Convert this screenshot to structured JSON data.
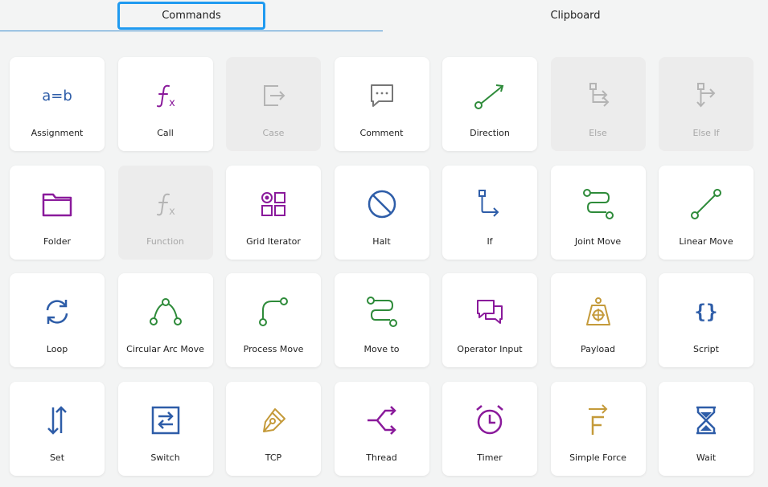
{
  "tabs": {
    "commands": "Commands",
    "clipboard": "Clipboard"
  },
  "colors": {
    "blue": "#2e5da8",
    "purple": "#8a1a9b",
    "green": "#2e8b3a",
    "gray": "#777777",
    "disabled": "#b4b4b4",
    "gold": "#c49a3a",
    "focus": "#1f9af0"
  },
  "commands": [
    {
      "label": "Assignment",
      "icon": "assignment-icon",
      "disabled": false
    },
    {
      "label": "Call",
      "icon": "function-icon",
      "disabled": false
    },
    {
      "label": "Case",
      "icon": "case-icon",
      "disabled": true
    },
    {
      "label": "Comment",
      "icon": "comment-icon",
      "disabled": false
    },
    {
      "label": "Direction",
      "icon": "direction-icon",
      "disabled": false
    },
    {
      "label": "Else",
      "icon": "else-icon",
      "disabled": true
    },
    {
      "label": "Else If",
      "icon": "else-if-icon",
      "disabled": true
    },
    {
      "label": "Folder",
      "icon": "folder-icon",
      "disabled": false
    },
    {
      "label": "Function",
      "icon": "function-icon",
      "disabled": true
    },
    {
      "label": "Grid Iterator",
      "icon": "grid-icon",
      "disabled": false
    },
    {
      "label": "Halt",
      "icon": "halt-icon",
      "disabled": false
    },
    {
      "label": "If",
      "icon": "if-icon",
      "disabled": false
    },
    {
      "label": "Joint Move",
      "icon": "joint-move-icon",
      "disabled": false
    },
    {
      "label": "Linear Move",
      "icon": "linear-move-icon",
      "disabled": false
    },
    {
      "label": "Loop",
      "icon": "loop-icon",
      "disabled": false
    },
    {
      "label": "Circular Arc Move",
      "icon": "circular-arc-icon",
      "disabled": false
    },
    {
      "label": "Process Move",
      "icon": "process-move-icon",
      "disabled": false
    },
    {
      "label": "Move to",
      "icon": "move-to-icon",
      "disabled": false
    },
    {
      "label": "Operator Input",
      "icon": "operator-input-icon",
      "disabled": false
    },
    {
      "label": "Payload",
      "icon": "payload-icon",
      "disabled": false
    },
    {
      "label": "Script",
      "icon": "script-icon",
      "disabled": false
    },
    {
      "label": "Set",
      "icon": "set-icon",
      "disabled": false
    },
    {
      "label": "Switch",
      "icon": "switch-icon",
      "disabled": false
    },
    {
      "label": "TCP",
      "icon": "tcp-icon",
      "disabled": false
    },
    {
      "label": "Thread",
      "icon": "thread-icon",
      "disabled": false
    },
    {
      "label": "Timer",
      "icon": "timer-icon",
      "disabled": false
    },
    {
      "label": "Simple Force",
      "icon": "simple-force-icon",
      "disabled": false
    },
    {
      "label": "Wait",
      "icon": "wait-icon",
      "disabled": false
    }
  ]
}
